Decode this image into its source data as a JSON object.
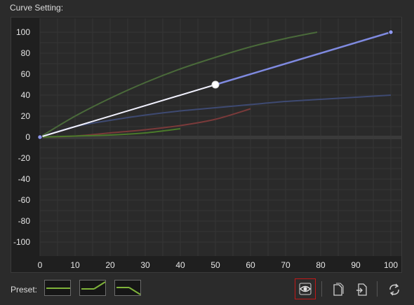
{
  "header": {
    "title": "Curve Setting:"
  },
  "chart_data": {
    "type": "line",
    "xlim": [
      0,
      100
    ],
    "ylim": [
      -100,
      100
    ],
    "x_ticks": [
      "0",
      "10",
      "20",
      "30",
      "40",
      "50",
      "60",
      "70",
      "80",
      "90",
      "100"
    ],
    "y_ticks": [
      "100",
      "80",
      "60",
      "40",
      "20",
      "0",
      "-20",
      "-40",
      "-60",
      "-80",
      "-100"
    ],
    "grid": true,
    "series": [
      {
        "color": "#7f8ae0",
        "active": true,
        "points": [
          [
            0,
            0
          ],
          [
            50,
            50
          ],
          [
            100,
            100
          ]
        ]
      },
      {
        "color": "#4a6a3a",
        "points": [
          [
            0,
            0
          ],
          [
            10,
            20
          ],
          [
            20,
            37
          ],
          [
            30,
            52
          ],
          [
            40,
            65
          ],
          [
            50,
            76
          ],
          [
            60,
            86
          ],
          [
            70,
            94
          ],
          [
            79,
            100
          ]
        ]
      },
      {
        "color": "#3e4a72",
        "points": [
          [
            0,
            0
          ],
          [
            10,
            10
          ],
          [
            20,
            16
          ],
          [
            30,
            21
          ],
          [
            40,
            25
          ],
          [
            50,
            28
          ],
          [
            60,
            31
          ],
          [
            70,
            34
          ],
          [
            80,
            36
          ],
          [
            90,
            38
          ],
          [
            100,
            40
          ]
        ]
      },
      {
        "color": "#7a3a3a",
        "points": [
          [
            0,
            0
          ],
          [
            10,
            1
          ],
          [
            20,
            4
          ],
          [
            30,
            7
          ],
          [
            40,
            11
          ],
          [
            50,
            17
          ],
          [
            60,
            27
          ]
        ]
      },
      {
        "color": "#4a7a2a",
        "points": [
          [
            0,
            0
          ],
          [
            10,
            1
          ],
          [
            20,
            2
          ],
          [
            30,
            4
          ],
          [
            40,
            8
          ]
        ]
      }
    ],
    "control_points": [
      [
        0,
        0
      ],
      [
        50,
        50
      ],
      [
        100,
        100
      ]
    ],
    "selected_point": [
      50,
      50
    ]
  },
  "preset": {
    "label": "Preset:",
    "items": [
      "preset-flat",
      "preset-rising",
      "preset-falling"
    ],
    "line_color": "#7fb33a"
  },
  "toolbar": {
    "buttons": [
      "eye-icon",
      "copy-icon",
      "import-icon",
      "refresh-icon"
    ]
  }
}
